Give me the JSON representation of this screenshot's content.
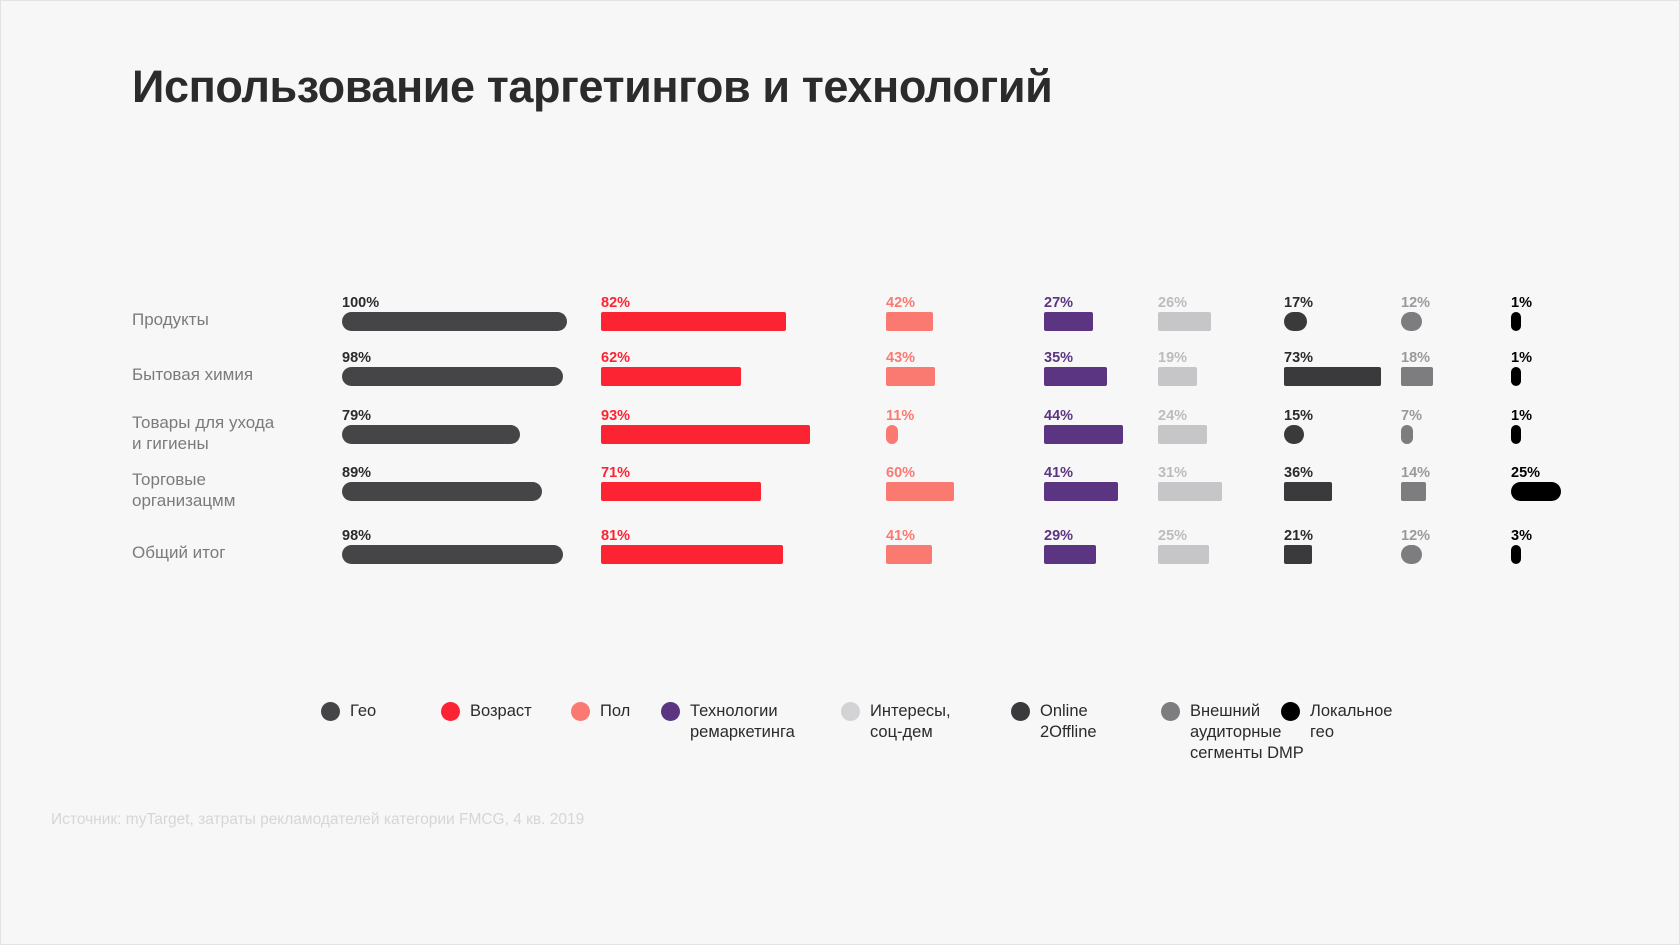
{
  "title": "Использование таргетингов и технологий",
  "source_note": "Источник: myTarget, затраты рекламодателей категории FMCG, 4 кв. 2019",
  "legend": {
    "items": [
      {
        "label": "Гео",
        "color": "#454547"
      },
      {
        "label": "Возраст",
        "color": "#fc2433"
      },
      {
        "label": "Пол",
        "color": "#fa7a72"
      },
      {
        "label": "Технологии\nремаркетинга",
        "color": "#5b3582"
      },
      {
        "label": "Интересы,\nсоц-дем",
        "color": "#d3d3d5"
      },
      {
        "label": "Online\n2Offline",
        "color": "#3a3a3c"
      },
      {
        "label": "Внешний\nаудиторные\nсегменты DMP",
        "color": "#7d7d80"
      },
      {
        "label": "Локальное\nгео",
        "color": "#000000"
      }
    ]
  },
  "chart_data": {
    "type": "bar",
    "orientation": "horizontal",
    "title": "Использование таргетингов и технологий",
    "xlabel": "",
    "ylabel": "",
    "grid": false,
    "legend_position": "bottom",
    "value_suffix": "%",
    "categories": [
      "Продукты",
      "Бытовая химия",
      "Товары для ухода\nи гигиены",
      "Торговые\nорганизацмм",
      "Общий итог"
    ],
    "series": [
      {
        "name": "Гео",
        "color": "#454547",
        "values": [
          100,
          98,
          79,
          89,
          98
        ],
        "label_color": "#2b2b2b"
      },
      {
        "name": "Возраст",
        "color": "#fc2433",
        "values": [
          82,
          62,
          93,
          71,
          81
        ],
        "label_color": "#fc2433"
      },
      {
        "name": "Пол",
        "color": "#fa7a72",
        "values": [
          42,
          43,
          11,
          60,
          41
        ],
        "label_color": "#fa7a72"
      },
      {
        "name": "Технологии ремаркетинга",
        "color": "#5b3582",
        "values": [
          27,
          35,
          44,
          41,
          29
        ],
        "label_color": "#5b3582"
      },
      {
        "name": "Интересы, соц-дем",
        "color": "#c6c6c8",
        "values": [
          26,
          19,
          24,
          31,
          25
        ],
        "label_color": "#bcbcbe"
      },
      {
        "name": "Online 2Offline",
        "color": "#3a3a3c",
        "values": [
          17,
          73,
          15,
          36,
          21
        ],
        "label_color": "#2b2b2b"
      },
      {
        "name": "Внешний аудиторные сегменты DMP",
        "color": "#7d7d80",
        "values": [
          12,
          18,
          7,
          14,
          12
        ],
        "label_color": "#9a9a9d"
      },
      {
        "name": "Локальное гео",
        "color": "#000000",
        "values": [
          1,
          1,
          1,
          25,
          3
        ],
        "label_color": "#000000"
      }
    ]
  }
}
